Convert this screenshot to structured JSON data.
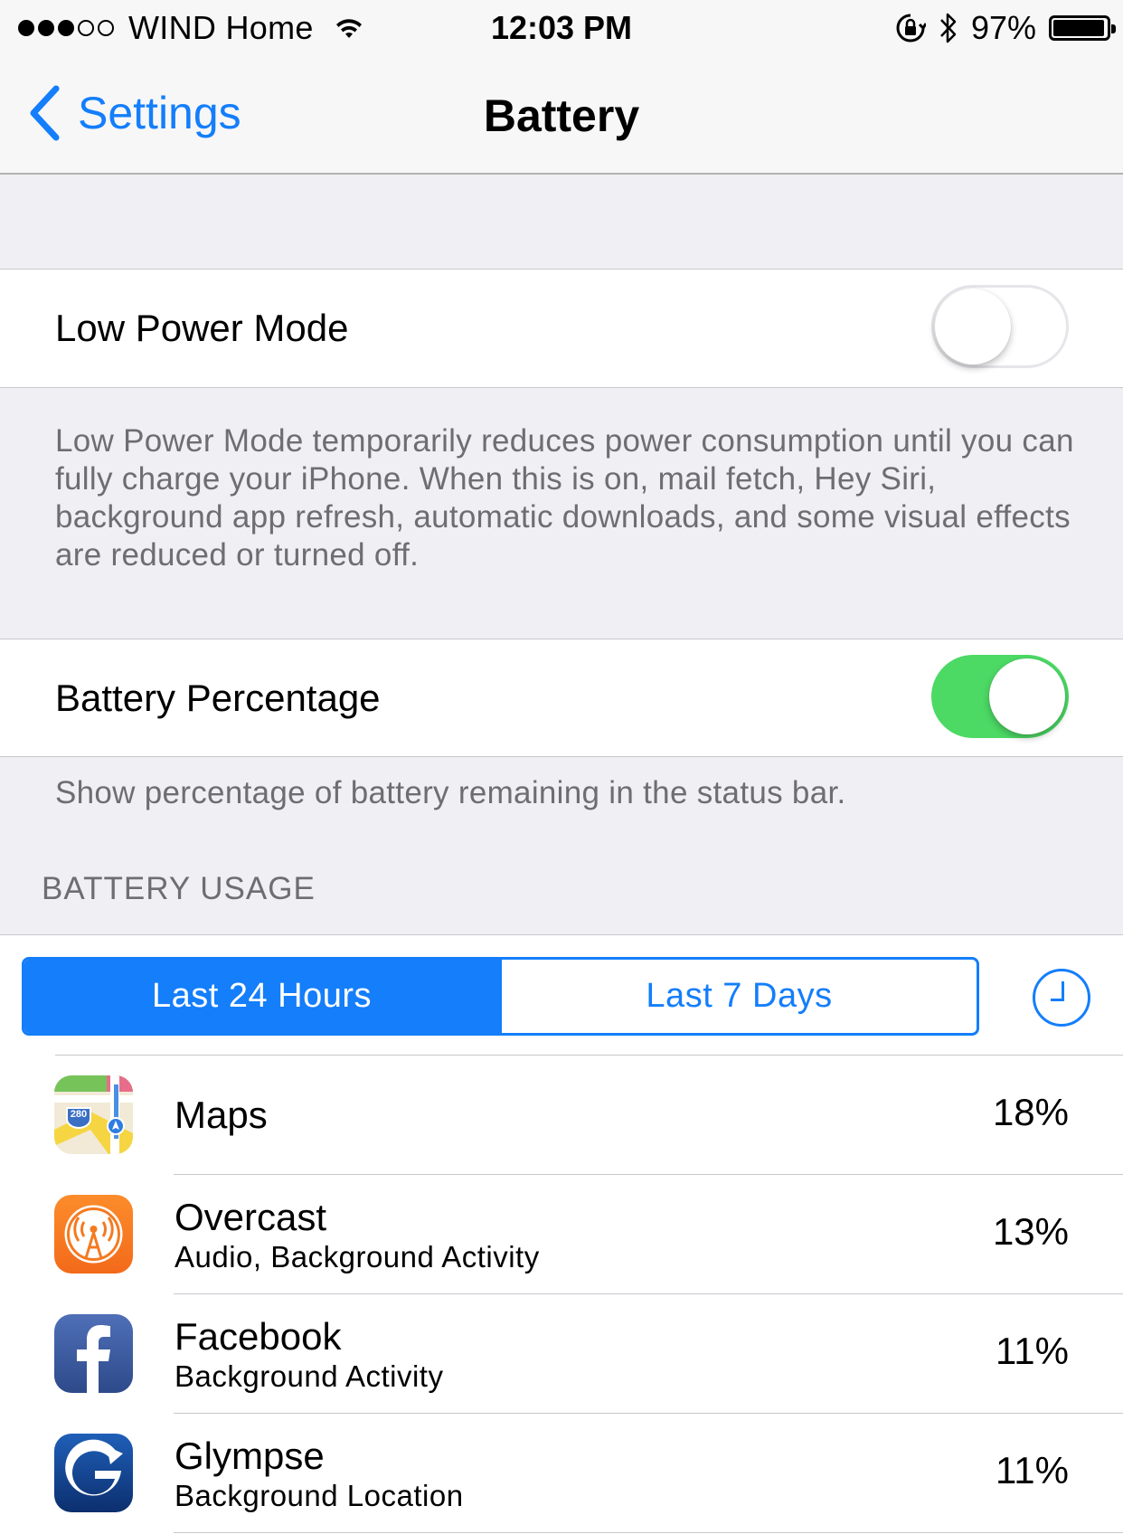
{
  "status_bar": {
    "carrier": "WIND Home",
    "time": "12:03 PM",
    "battery_percent": "97%",
    "signal_bars_filled": 3,
    "signal_bars_total": 5,
    "battery_level": 0.97
  },
  "nav": {
    "back_label": "Settings",
    "title": "Battery"
  },
  "low_power": {
    "label": "Low Power Mode",
    "enabled": false,
    "footer": "Low Power Mode temporarily reduces power consumption until you can fully charge your iPhone. When this is on, mail fetch, Hey Siri, background app refresh, automatic downloads, and some visual effects are reduced or turned off."
  },
  "battery_percentage": {
    "label": "Battery Percentage",
    "enabled": true,
    "footer": "Show percentage of battery remaining in the status bar."
  },
  "usage": {
    "header": "BATTERY USAGE",
    "segments": [
      "Last 24 Hours",
      "Last 7 Days"
    ],
    "selected_segment": 0,
    "apps": [
      {
        "name": "Maps",
        "detail": "",
        "percent": "18%",
        "icon": "maps-app-icon"
      },
      {
        "name": "Overcast",
        "detail": "Audio, Background Activity",
        "percent": "13%",
        "icon": "overcast-app-icon"
      },
      {
        "name": "Facebook",
        "detail": "Background Activity",
        "percent": "11%",
        "icon": "facebook-app-icon"
      },
      {
        "name": "Glympse",
        "detail": "Background Location",
        "percent": "11%",
        "icon": "glympse-app-icon"
      }
    ]
  },
  "colors": {
    "accent": "#147efb",
    "toggle_on": "#4cd964",
    "background": "#efeff4",
    "footer_text": "#6d6d72"
  }
}
